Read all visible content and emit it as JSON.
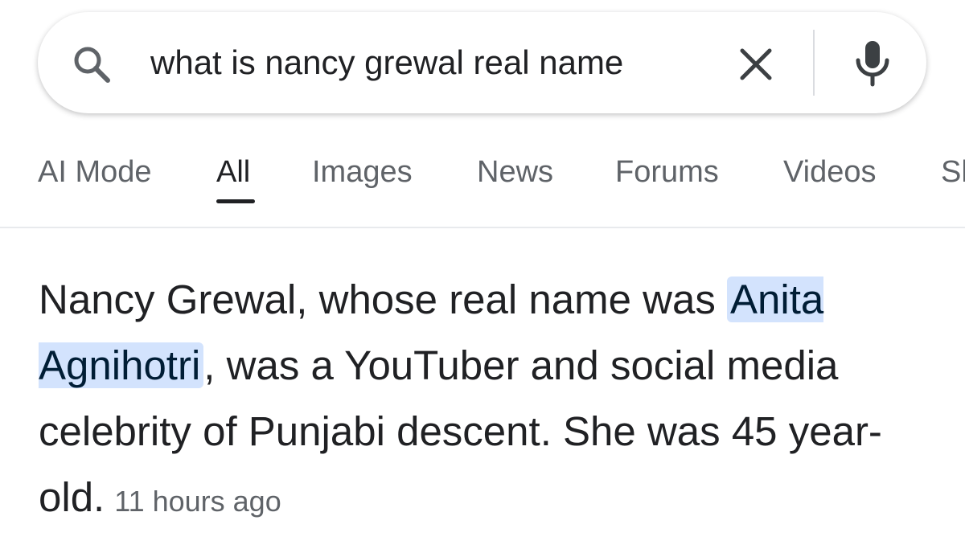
{
  "search": {
    "query": "what is nancy grewal real name"
  },
  "tabs": [
    {
      "label": "AI Mode"
    },
    {
      "label": "All"
    },
    {
      "label": "Images"
    },
    {
      "label": "News"
    },
    {
      "label": "Forums"
    },
    {
      "label": "Videos"
    },
    {
      "label": "Sh"
    }
  ],
  "answer": {
    "part1": "Nancy Grewal, whose real name was ",
    "highlight": "Anita Agnihotri",
    "part2": ", was a YouTuber and social media celebrity of Punjabi descent. She was 45 year-old.",
    "timestamp": "11 hours ago"
  },
  "colors": {
    "highlight_bg": "#d3e3fd",
    "text": "#202124",
    "secondary": "#5f6368"
  }
}
